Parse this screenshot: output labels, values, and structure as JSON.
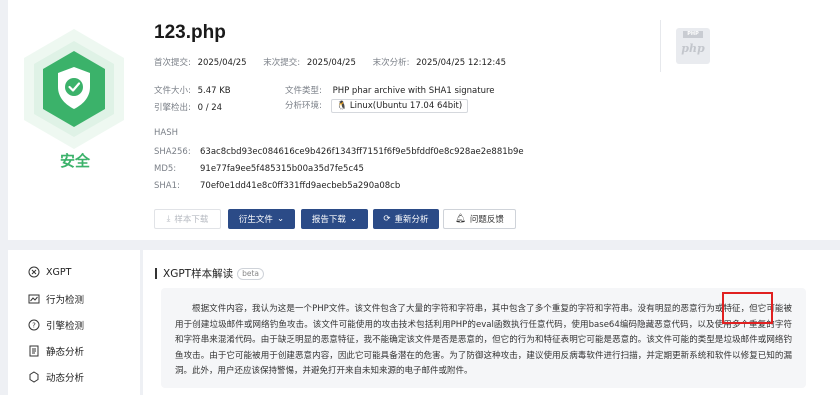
{
  "file": {
    "name": "123.php",
    "verdict": "安全",
    "first_submit_label": "首次提交:",
    "first_submit": "2025/04/25",
    "last_submit_label": "末次提交:",
    "last_submit": "2025/04/25",
    "last_analysis_label": "末次分析:",
    "last_analysis": "2025/04/25 12:12:45",
    "size_label": "文件大小:",
    "size": "5.47 KB",
    "type_label": "文件类型:",
    "type": "PHP phar archive with SHA1 signature",
    "engines_label": "引擎检出:",
    "engines": "0 / 24",
    "env_label": "分析环境:",
    "env": "Linux(Ubuntu 17.04 64bit)",
    "hash_label": "HASH",
    "sha256_label": "SHA256:",
    "sha256": "63ac8cbd93ec084616ce9b426f1343ff7151f6f9e5bfddf0e8c928ae2e881b9e",
    "md5_label": "MD5:",
    "md5": "91e77fa9ee5f485315b00a35d7fe5c45",
    "sha1_label": "SHA1:",
    "sha1": "70ef0e1dd41e8c0ff331ffd9aecbeb5a290a08cb",
    "icon_tag": "PHP",
    "icon_text": "php"
  },
  "actions": {
    "download": "样本下载",
    "derived": "衍生文件",
    "report": "报告下载",
    "reanalyze": "重新分析",
    "feedback": "问题反馈"
  },
  "sidebar": {
    "items": [
      {
        "label": "XGPT",
        "icon": "xgpt-icon"
      },
      {
        "label": "行为检测",
        "icon": "behavior-icon"
      },
      {
        "label": "引擎检测",
        "icon": "engine-icon"
      },
      {
        "label": "静态分析",
        "icon": "static-icon"
      },
      {
        "label": "动态分析",
        "icon": "dynamic-icon"
      }
    ]
  },
  "xgpt": {
    "title": "XGPT样本解读",
    "badge": "beta",
    "text": "根据文件内容，我认为这是一个PHP文件。该文件包含了大量的字符和字符串，其中包含了多个重复的字符和字符串。没有明显的恶意行为或特征，但它可能被用于创建垃圾邮件或网络钓鱼攻击。该文件可能使用的攻击技术包括利用PHP的eval函数执行任意代码，使用base64编码隐藏恶意代码，以及使用多个重复的字符和字符串来混淆代码。由于缺乏明显的恶意特征，我不能确定该文件是否是恶意的，但它的行为和特征表明它可能是恶意的。该文件可能的类型是垃圾邮件或网络钓鱼攻击。由于它可能被用于创建恶意内容，因此它可能具备潜在的危害。为了防御这种攻击，建议使用反病毒软件进行扫描，并定期更新系统和软件以修复已知的漏洞。此外，用户还应该保持警惕，并避免打开来自未知来源的电子邮件或附件。"
  },
  "colors": {
    "safe": "#3bb26a",
    "primary": "#2b4b87",
    "highlight": "#e02020"
  }
}
